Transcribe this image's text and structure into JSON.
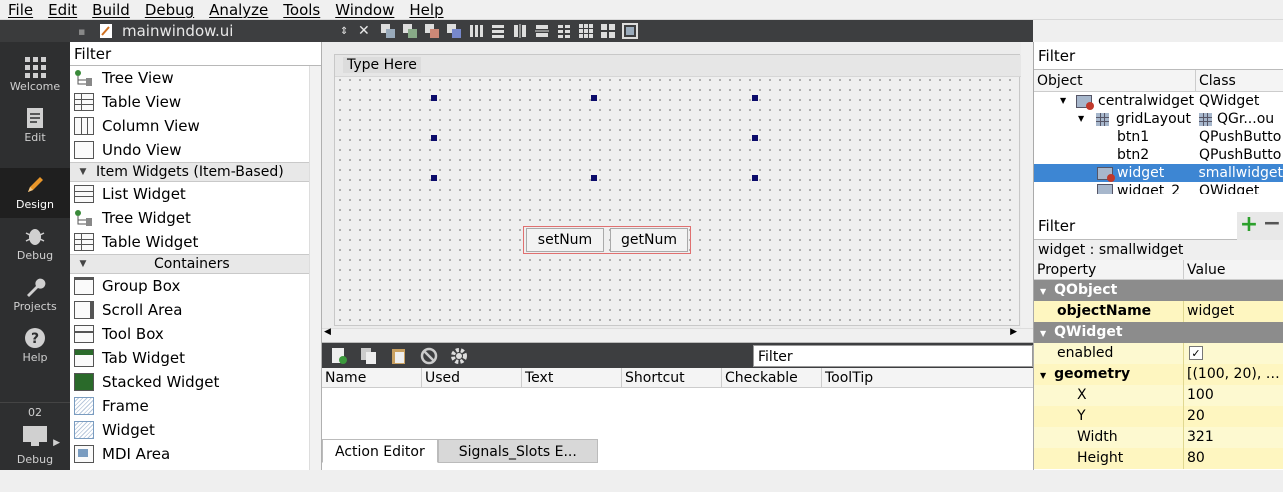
{
  "menu": [
    "File",
    "Edit",
    "Build",
    "Debug",
    "Analyze",
    "Tools",
    "Window",
    "Help"
  ],
  "modes": [
    {
      "label": "Welcome",
      "icon": "grid-icon",
      "active": false
    },
    {
      "label": "Edit",
      "icon": "document-icon",
      "active": false
    },
    {
      "label": "Design",
      "icon": "pencil-icon",
      "active": true
    },
    {
      "label": "Debug",
      "icon": "bug-icon",
      "active": false
    },
    {
      "label": "Projects",
      "icon": "wrench-icon",
      "active": false
    },
    {
      "label": "Help",
      "icon": "help-icon",
      "active": false
    }
  ],
  "kit": {
    "project_number": "02",
    "label": "Debug"
  },
  "editor": {
    "filename": "mainwindow.ui"
  },
  "widgetbox": {
    "filter": "Filter",
    "items1": [
      "Tree View",
      "Table View",
      "Column View",
      "Undo View"
    ],
    "cat_item_based": "Item Widgets (Item-Based)",
    "items2": [
      "List Widget",
      "Tree Widget",
      "Table Widget"
    ],
    "cat_containers": "Containers",
    "items3": [
      "Group Box",
      "Scroll Area",
      "Tool Box",
      "Tab Widget",
      "Stacked Widget",
      "Frame",
      "Widget",
      "MDI Area"
    ]
  },
  "form": {
    "menu_placeholder": "Type Here",
    "buttons": [
      "setNum",
      "getNum"
    ]
  },
  "action_editor": {
    "filter": "Filter",
    "columns": [
      "Name",
      "Used",
      "Text",
      "Shortcut",
      "Checkable",
      "ToolTip"
    ],
    "tabs": [
      "Action Editor",
      "Signals_Slots E..."
    ]
  },
  "object_inspector": {
    "filter": "Filter",
    "columns": [
      "Object",
      "Class"
    ],
    "rows": [
      {
        "object": "centralwidget",
        "class": "QWidget"
      },
      {
        "object": "gridLayout",
        "class": "QGr...ou"
      },
      {
        "object": "btn1",
        "class": "QPushButto"
      },
      {
        "object": "btn2",
        "class": "QPushButto"
      },
      {
        "object": "widget",
        "class": "smallwidget"
      },
      {
        "object": "widget_2",
        "class": "QWidget"
      }
    ]
  },
  "property_editor": {
    "filter": "Filter",
    "title": "widget : smallwidget",
    "columns": [
      "Property",
      "Value"
    ],
    "rows": [
      {
        "name": "QObject",
        "value": ""
      },
      {
        "name": "objectName",
        "value": "widget"
      },
      {
        "name": "QWidget",
        "value": ""
      },
      {
        "name": "enabled",
        "value": "✓"
      },
      {
        "name": "geometry",
        "value": "[(100, 20), …"
      },
      {
        "name": "X",
        "value": "100"
      },
      {
        "name": "Y",
        "value": "20"
      },
      {
        "name": "Width",
        "value": "321"
      },
      {
        "name": "Height",
        "value": "80"
      }
    ]
  }
}
